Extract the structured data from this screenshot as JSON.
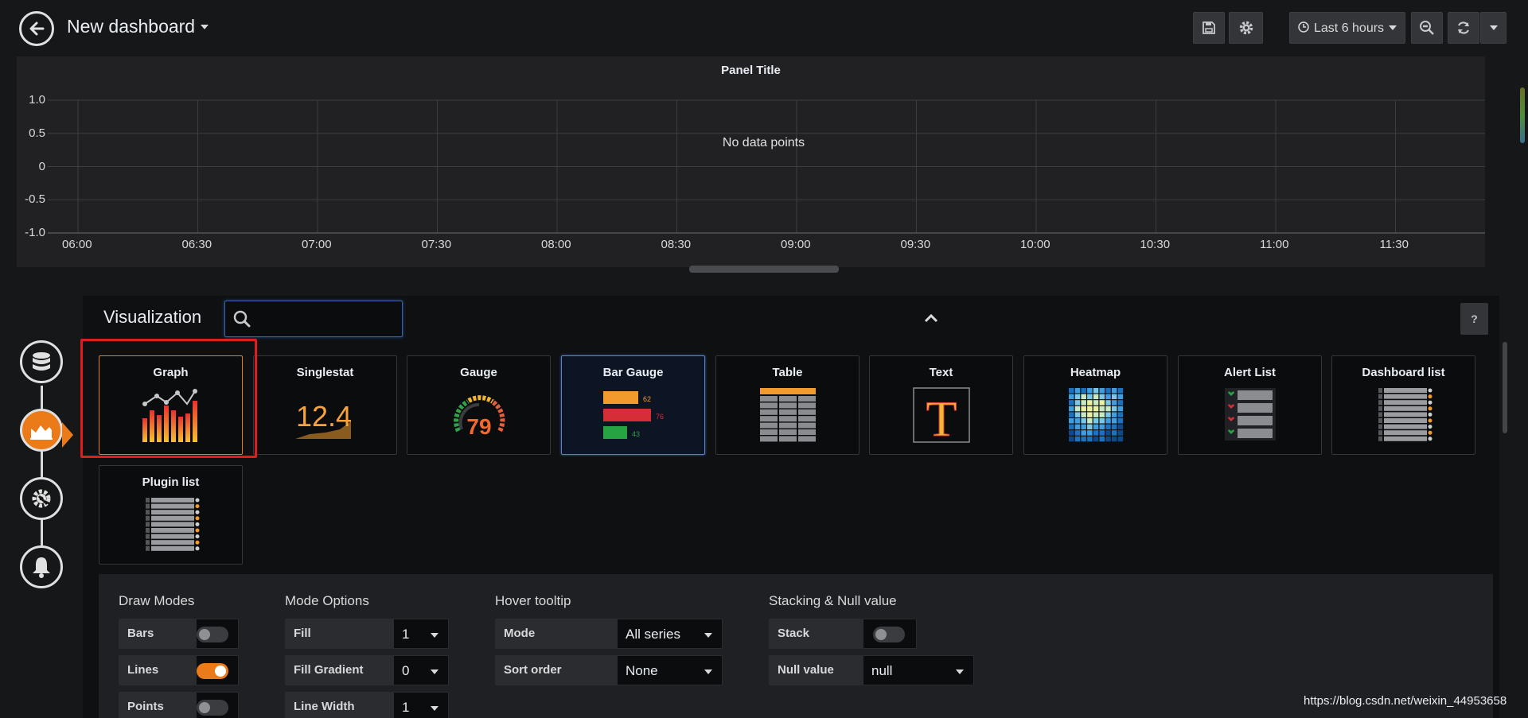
{
  "topbar": {
    "title": "New dashboard",
    "time_range": "Last 6 hours"
  },
  "panel": {
    "title": "Panel Title",
    "message": "No data points",
    "y_ticks": [
      "1.0",
      "0.5",
      "0",
      "-0.5",
      "-1.0"
    ],
    "x_ticks": [
      "06:00",
      "06:30",
      "07:00",
      "07:30",
      "08:00",
      "08:30",
      "09:00",
      "09:30",
      "10:00",
      "10:30",
      "11:00",
      "11:30"
    ]
  },
  "visualization": {
    "heading": "Visualization",
    "search_value": "",
    "help_label": "?",
    "cards": [
      {
        "name": "Graph",
        "icon": "graph-icon"
      },
      {
        "name": "Singlestat",
        "icon": "singlestat-icon",
        "value": "12.4"
      },
      {
        "name": "Gauge",
        "icon": "gauge-icon",
        "value": "79"
      },
      {
        "name": "Bar Gauge",
        "icon": "bar-gauge-icon",
        "values": [
          "62",
          "76",
          "43"
        ]
      },
      {
        "name": "Table",
        "icon": "table-icon"
      },
      {
        "name": "Text",
        "icon": "text-icon",
        "glyph": "T"
      },
      {
        "name": "Heatmap",
        "icon": "heatmap-icon"
      },
      {
        "name": "Alert List",
        "icon": "alert-list-icon"
      },
      {
        "name": "Dashboard list",
        "icon": "dashboard-list-icon"
      },
      {
        "name": "Plugin list",
        "icon": "plugin-list-icon"
      }
    ],
    "selected": "Graph",
    "hovered": "Bar Gauge"
  },
  "steps": [
    "queries-icon",
    "visualization-icon",
    "general-settings-icon",
    "alert-icon"
  ],
  "options": {
    "draw_modes": {
      "title": "Draw Modes",
      "bars_label": "Bars",
      "bars_on": false,
      "lines_label": "Lines",
      "lines_on": true,
      "points_label": "Points",
      "points_on": false
    },
    "mode_options": {
      "title": "Mode Options",
      "fill_label": "Fill",
      "fill_value": "1",
      "fill_gradient_label": "Fill Gradient",
      "fill_gradient_value": "0",
      "line_width_label": "Line Width",
      "line_width_value": "1"
    },
    "hover_tooltip": {
      "title": "Hover tooltip",
      "mode_label": "Mode",
      "mode_value": "All series",
      "sort_label": "Sort order",
      "sort_value": "None"
    },
    "stacking": {
      "title": "Stacking & Null value",
      "stack_label": "Stack",
      "stack_on": false,
      "null_label": "Null value",
      "null_value": "null"
    }
  },
  "watermark": "https://blog.csdn.net/weixin_44953658",
  "colors": {
    "accent": "#eb7b18",
    "selection_box": "#e01c1c",
    "hover_border": "#5a7fcf"
  }
}
